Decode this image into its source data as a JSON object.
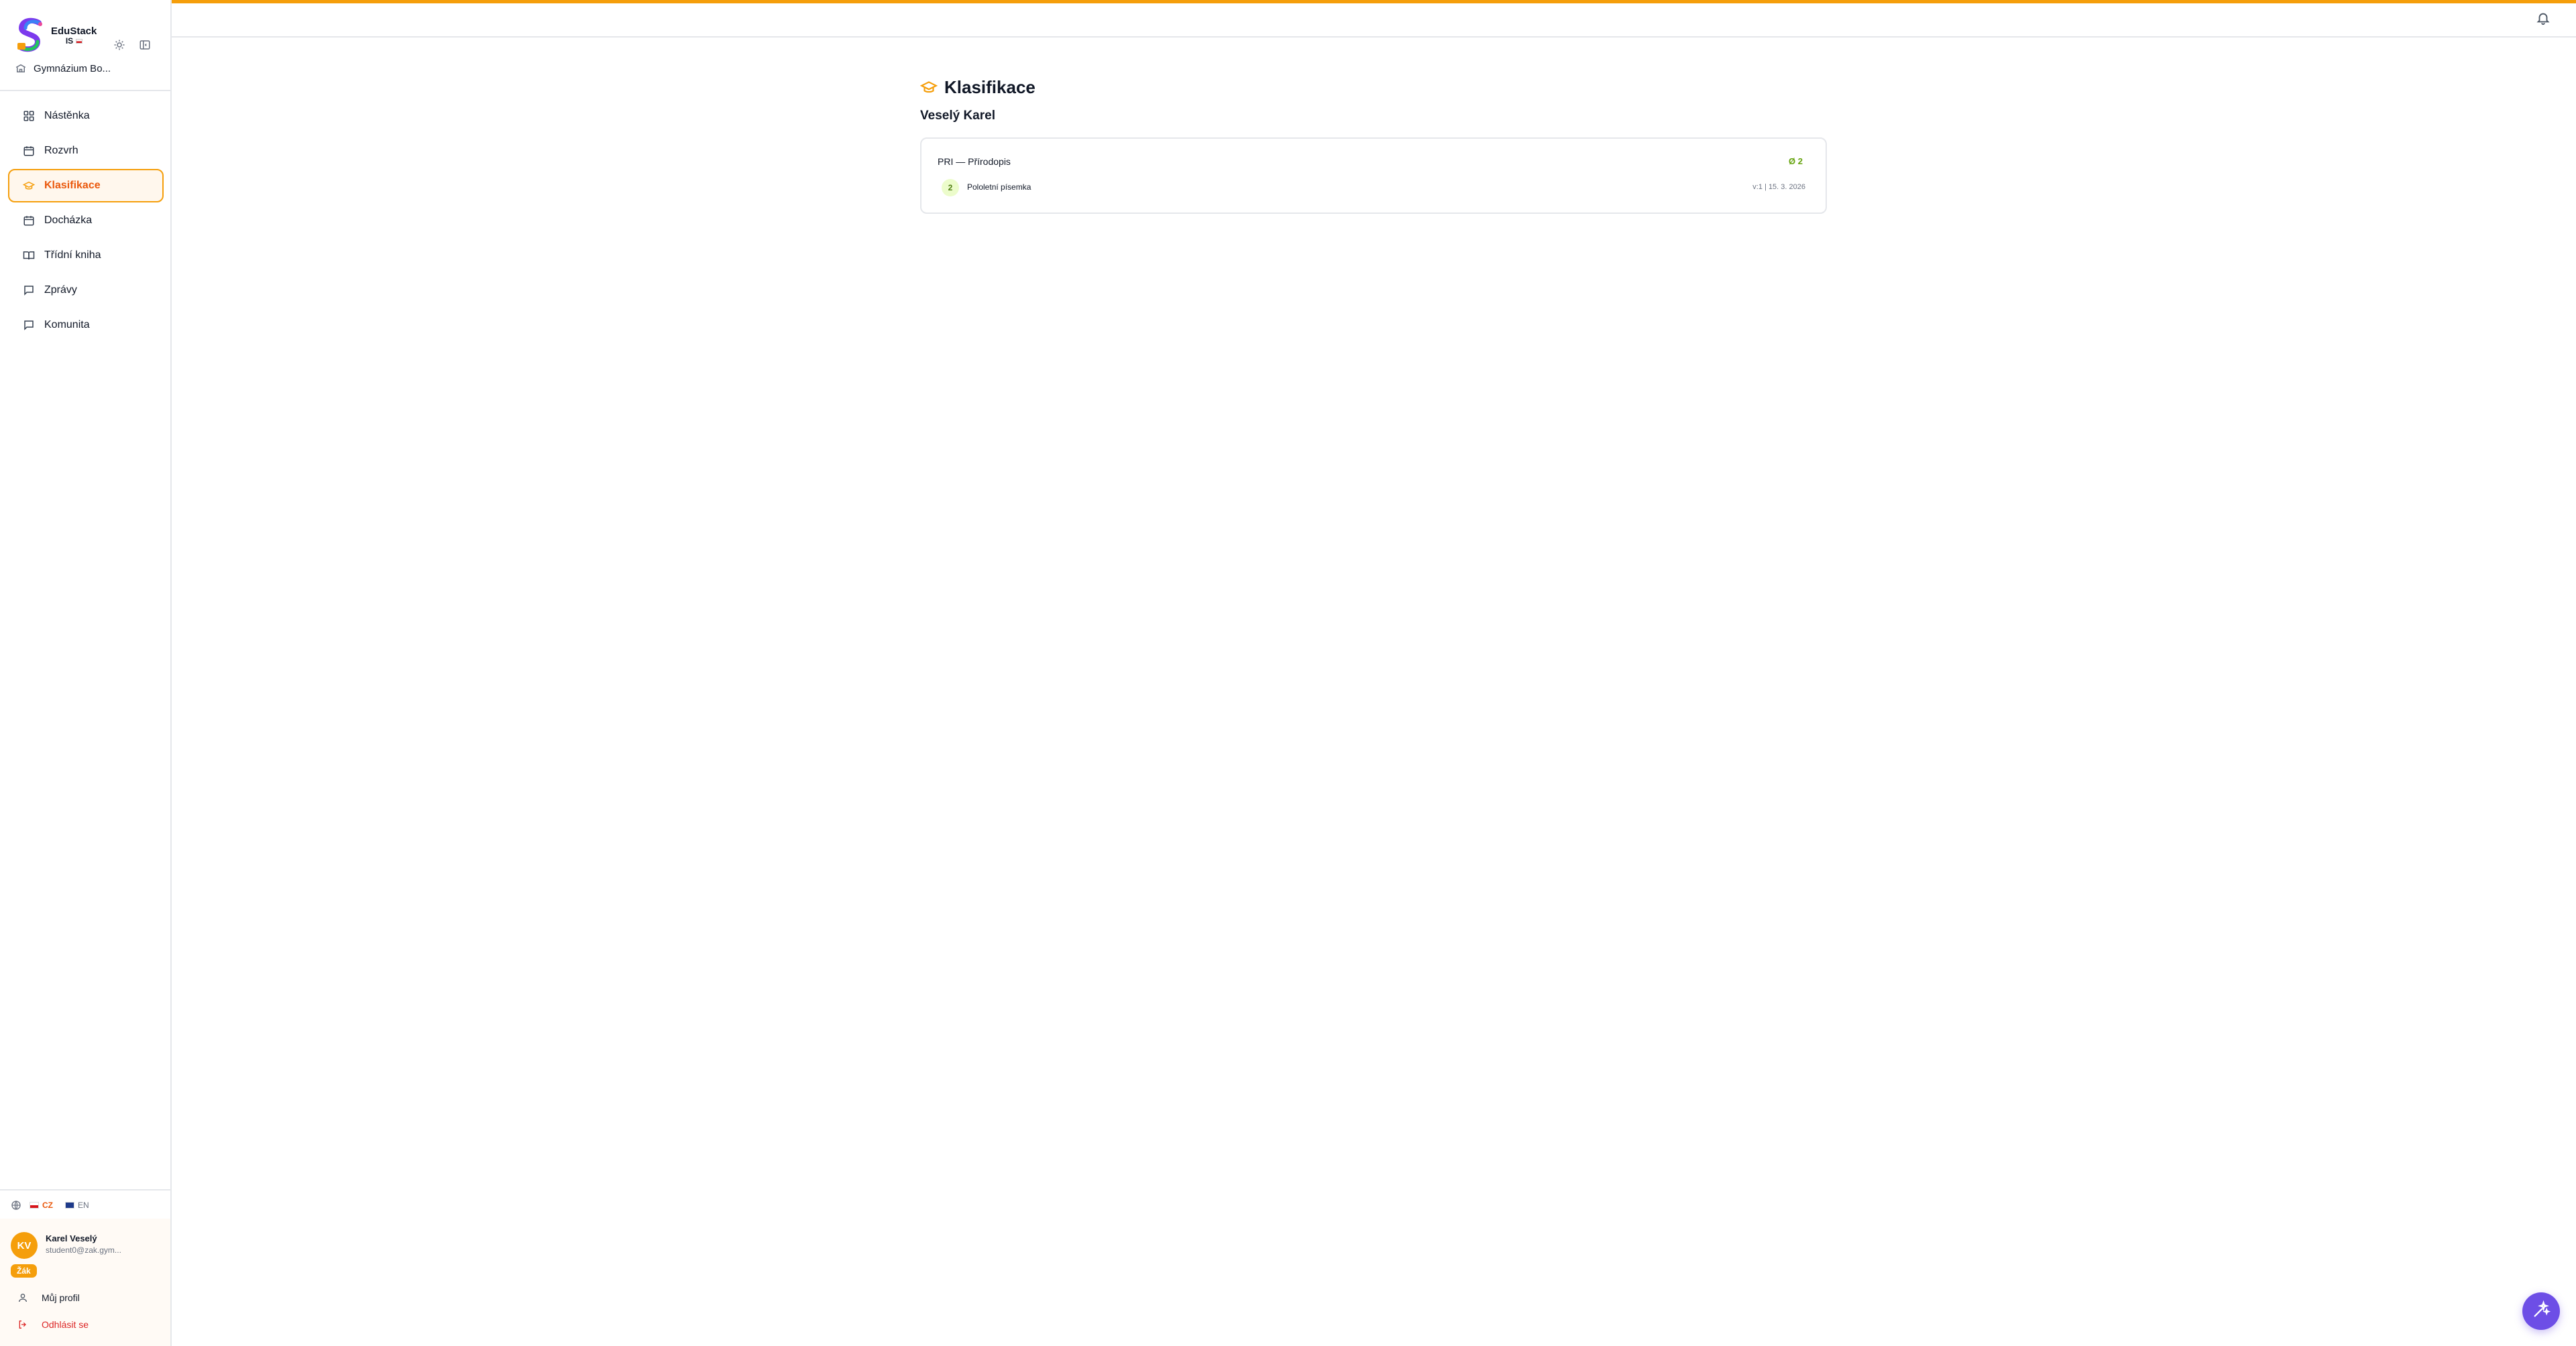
{
  "brand": {
    "name_line1": "EduStack",
    "name_line2": "IS"
  },
  "school": {
    "name": "Gymnázium Bo..."
  },
  "sidebar": {
    "items": [
      {
        "label": "Nástěnka",
        "icon": "dashboard-icon"
      },
      {
        "label": "Rozvrh",
        "icon": "calendar-icon"
      },
      {
        "label": "Klasifikace",
        "icon": "graduation-cap-icon",
        "active": true
      },
      {
        "label": "Docházka",
        "icon": "calendar-check-icon"
      },
      {
        "label": "Třídní kniha",
        "icon": "book-open-icon"
      },
      {
        "label": "Zprávy",
        "icon": "message-icon"
      },
      {
        "label": "Komunita",
        "icon": "message-icon"
      }
    ]
  },
  "language": {
    "options": [
      {
        "code": "CZ",
        "active": true
      },
      {
        "code": "EN",
        "active": false
      }
    ]
  },
  "user": {
    "initials": "KV",
    "name": "Karel Veselý",
    "email": "student0@zak.gym...",
    "role": "Žák",
    "profile_label": "Můj profil",
    "logout_label": "Odhlásit se"
  },
  "page": {
    "title": "Klasifikace",
    "student": "Veselý Karel",
    "subjects": [
      {
        "name": "PRI — Přírodopis",
        "average": "Ø 2",
        "grades": [
          {
            "value": "2",
            "name": "Pololetní písemka",
            "meta": "v:1 | 15. 3. 2026"
          }
        ]
      }
    ]
  },
  "colors": {
    "accent": "#f59e0b",
    "active_text": "#ea580c",
    "grade_green": "#65a30d",
    "fab": "#6d4ee6"
  }
}
